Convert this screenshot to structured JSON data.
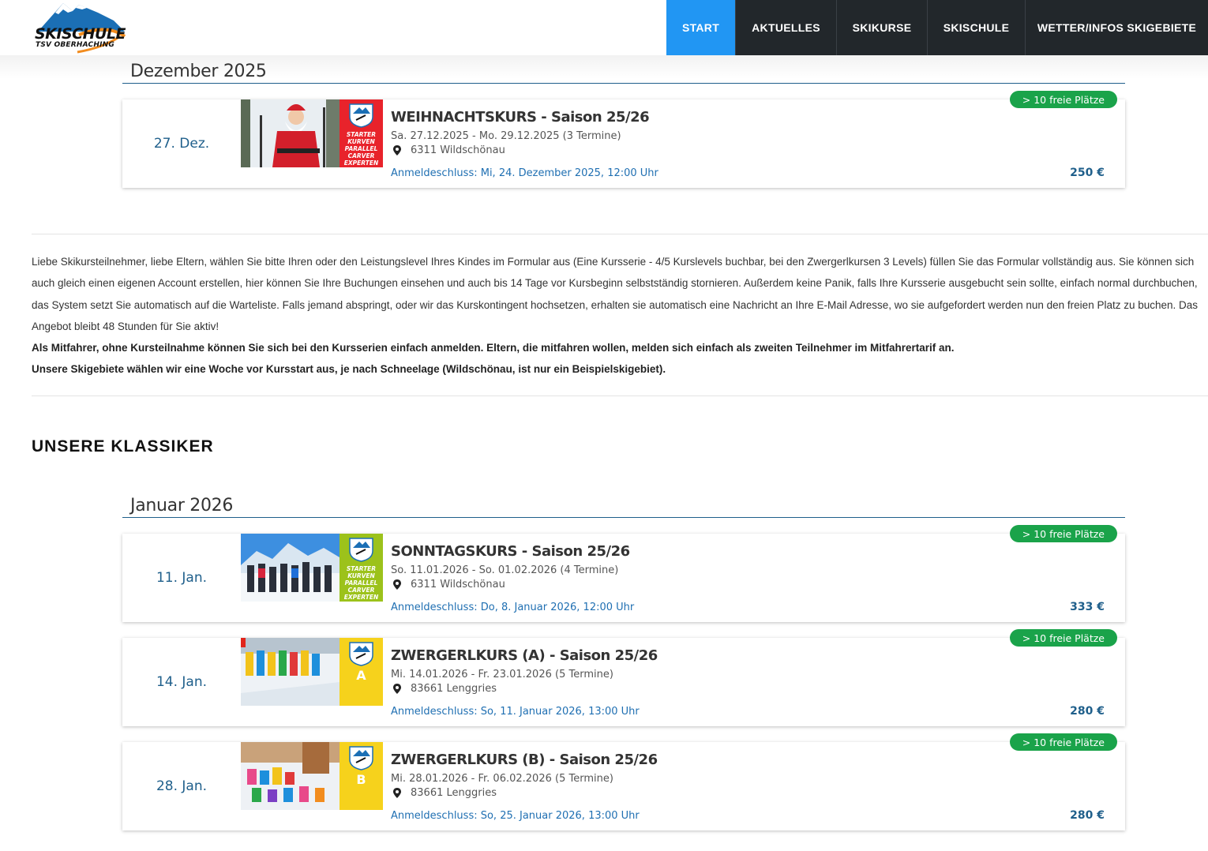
{
  "header": {
    "logo_line1": "SKISCHULE",
    "logo_line2": "TSV OBERHACHING",
    "nav": [
      {
        "label": "START",
        "active": true
      },
      {
        "label": "AKTUELLES",
        "active": false
      },
      {
        "label": "SKIKURSE",
        "active": false
      },
      {
        "label": "SKISCHULE",
        "active": false
      },
      {
        "label": "WETTER/INFOS SKIGEBIETE",
        "active": false
      }
    ]
  },
  "months": {
    "dec": "Dezember 2025",
    "jan": "Januar 2026"
  },
  "courses": [
    {
      "date": "27. Dez.",
      "title": "WEIHNACHTSKURS - Saison 25/26",
      "dates": "Sa. 27.12.2025 - Mo. 29.12.2025 (3 Termine)",
      "location": "6311 Wildschönau",
      "deadline": "Anmeldeschluss: Mi, 24. Dezember 2025, 12:00 Uhr",
      "price": "250 €",
      "badge": "> 10 freie Plätze",
      "brand_color": "#e8232b",
      "brand_words": [
        "STARTER",
        "KURVEN",
        "PARALLEL",
        "CARVER",
        "EXPERTEN"
      ]
    },
    {
      "date": "11. Jan.",
      "title": "SONNTAGSKURS - Saison 25/26",
      "dates": "So. 11.01.2026 - So. 01.02.2026 (4 Termine)",
      "location": "6311 Wildschönau",
      "deadline": "Anmeldeschluss: Do, 8. Januar 2026, 12:00 Uhr",
      "price": "333 €",
      "badge": "> 10 freie Plätze",
      "brand_color": "#9cc21b",
      "brand_words": [
        "STARTER",
        "KURVEN",
        "PARALLEL",
        "CARVER",
        "EXPERTEN"
      ]
    },
    {
      "date": "14. Jan.",
      "title": "ZWERGERLKURS (A) - Saison 25/26",
      "dates": "Mi. 14.01.2026 - Fr. 23.01.2026 (5 Termine)",
      "location": "83661 Lenggries",
      "deadline": "Anmeldeschluss: So, 11. Januar 2026, 13:00 Uhr",
      "price": "280 €",
      "badge": "> 10 freie Plätze",
      "brand_color": "#f6d21c",
      "brand_letter": "A"
    },
    {
      "date": "28. Jan.",
      "title": "ZWERGERLKURS (B) - Saison 25/26",
      "dates": "Mi. 28.01.2026 - Fr. 06.02.2026 (5 Termine)",
      "location": "83661 Lenggries",
      "deadline": "Anmeldeschluss: So, 25. Januar 2026, 13:00 Uhr",
      "price": "280 €",
      "badge": "> 10 freie Plätze",
      "brand_color": "#f6d21c",
      "brand_letter": "B"
    }
  ],
  "info": {
    "paragraph": "Liebe Skikursteilnehmer, liebe Eltern, wählen Sie bitte Ihren oder den Leistungslevel Ihres Kindes im Formular aus (Eine Kursserie - 4/5 Kurslevels buchbar, bei den Zwergerlkursen 3 Levels) füllen Sie das Formular vollständig aus. Sie können sich auch gleich einen eigenen Account erstellen, hier können Sie Ihre Buchungen einsehen und auch bis 14 Tage vor Kursbeginn selbstständig stornieren. Außerdem keine Panik, falls Ihre Kursserie ausgebucht sein sollte, einfach normal durchbuchen, das System setzt Sie automatisch auf die Warteliste. Falls jemand abspringt, oder wir das Kurskontingent hochsetzen, erhalten sie automatisch eine Nachricht an Ihre E-Mail Adresse, wo sie aufgefordert werden nun den freien Platz zu buchen. Das Angebot bleibt 48 Stunden für Sie aktiv!",
    "bold1": "Als Mitfahrer, ohne Kursteilnahme können Sie sich bei den Kursserien einfach anmelden. Eltern, die mitfahren wollen, melden sich einfach als zweiten Teilnehmer im Mitfahrertarif an.",
    "bold2": "Unsere Skigebiete wählen wir eine Woche vor Kursstart aus, je nach Schneelage (Wildschönau, ist nur ein Beispielskigebiet)."
  },
  "section": {
    "classics_title": "UNSERE KLASSIKER"
  }
}
